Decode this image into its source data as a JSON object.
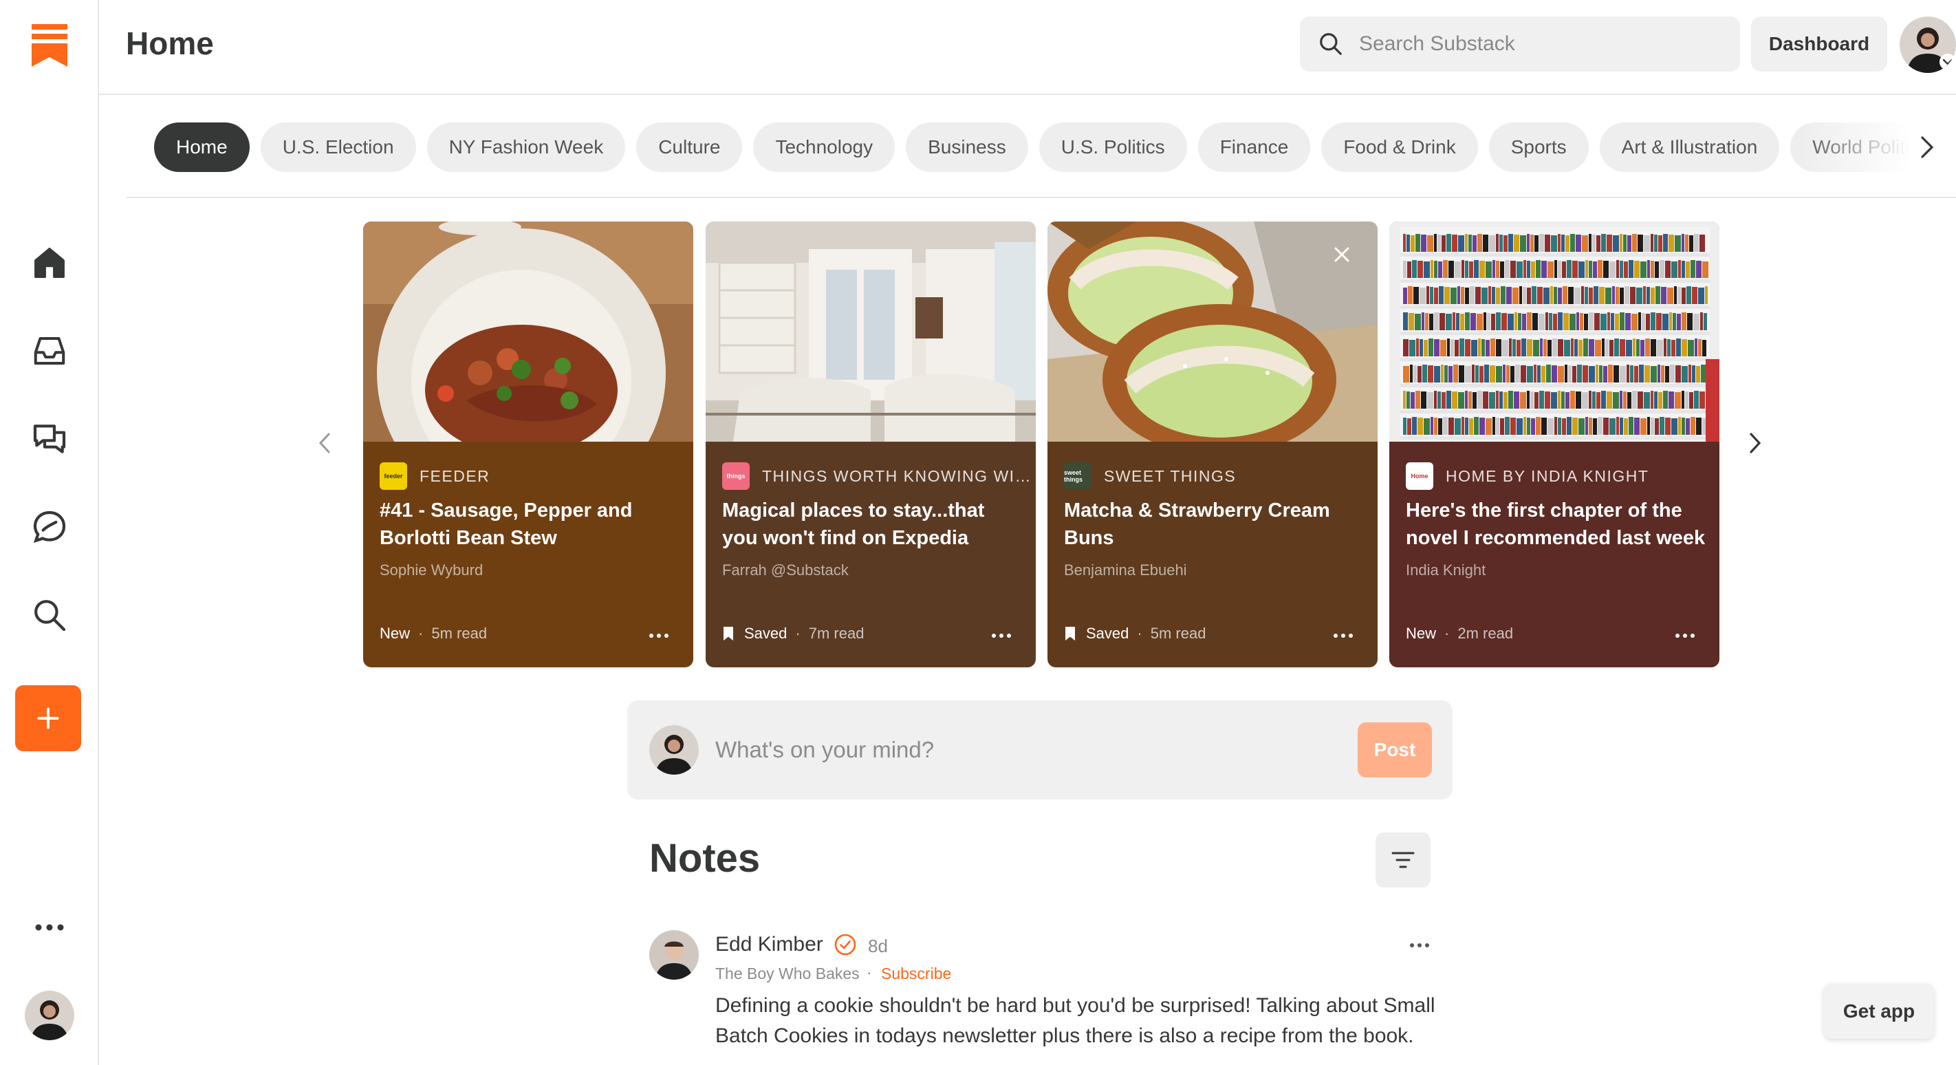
{
  "header": {
    "title": "Home",
    "search_placeholder": "Search Substack",
    "dashboard_label": "Dashboard"
  },
  "rail": {
    "items": [
      {
        "name": "home",
        "icon": "home-icon"
      },
      {
        "name": "inbox",
        "icon": "inbox-icon"
      },
      {
        "name": "chat",
        "icon": "chat-icon"
      },
      {
        "name": "activity",
        "icon": "activity-icon"
      },
      {
        "name": "search",
        "icon": "search-icon"
      },
      {
        "name": "more",
        "icon": "more-icon"
      }
    ],
    "compose_icon": "plus-icon"
  },
  "categories": [
    "Home",
    "U.S. Election",
    "NY Fashion Week",
    "Culture",
    "Technology",
    "Business",
    "U.S. Politics",
    "Finance",
    "Food & Drink",
    "Sports",
    "Art & Illustration",
    "World Politics"
  ],
  "active_category": "Home",
  "cards": [
    {
      "publication": "FEEDER",
      "publication_logo_text": "feeder",
      "title": "#41 - Sausage, Pepper and Borlotti Bean Stew",
      "author": "Sophie Wyburd",
      "status": "New",
      "read_time": "5m read",
      "color": "#6f3f12",
      "logo_color": "#f2d000"
    },
    {
      "publication": "THINGS WORTH KNOWING WIT...",
      "publication_logo_text": "things",
      "title": "Magical places to stay...that you won't find on Expedia",
      "author": "Farrah @Substack",
      "status": "Saved",
      "read_time": "7m read",
      "color": "#5b3a24",
      "logo_color": "#f06b7f"
    },
    {
      "publication": "SWEET THINGS",
      "publication_logo_text": "sweet things",
      "title": "Matcha & Strawberry Cream Buns",
      "author": "Benjamina Ebuehi",
      "status": "Saved",
      "read_time": "5m read",
      "color": "#5f3a1d",
      "logo_color": "#3d4a34"
    },
    {
      "publication": "HOME BY INDIA KNIGHT",
      "publication_logo_text": "Home",
      "title": "Here's the first chapter of the novel I recommended last week",
      "author": "India Knight",
      "status": "New",
      "read_time": "2m read",
      "color": "#5c2b25",
      "logo_color": "#ffffff"
    }
  ],
  "composer": {
    "placeholder": "What's on your mind?",
    "post_label": "Post"
  },
  "notes": {
    "title": "Notes",
    "note": {
      "author": "Edd Kimber",
      "time": "8d",
      "publication": "The Boy Who Bakes",
      "separator": "·",
      "subscribe_label": "Subscribe",
      "text": "Defining a cookie shouldn't be hard but you'd be surprised! Talking about Small Batch Cookies in todays newsletter plus there is also a recipe from the book."
    }
  },
  "get_app_label": "Get app",
  "colors": {
    "accent": "#ff6719",
    "post_button": "#ffb08a",
    "text": "#363737"
  }
}
